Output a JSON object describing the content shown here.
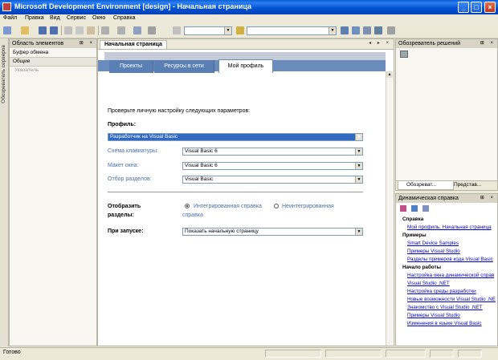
{
  "window": {
    "title": "Microsoft Development Environment [design] - Начальная страница"
  },
  "menu": [
    "Файл",
    "Правка",
    "Вид",
    "Сервис",
    "Окно",
    "Справка"
  ],
  "left_strip": {
    "label": "Обозреватель серверов"
  },
  "toolbox": {
    "title": "Область элементов",
    "sections": [
      "Буфер обмена",
      "Общие"
    ],
    "item": "Указатель"
  },
  "document": {
    "tab": "Начальная страница",
    "nav_tabs": [
      "Проекты",
      "Ресурсы в сети",
      "Мой профиль"
    ],
    "intro": "Проверьте личную настройку следующих параметров:",
    "profile_label": "Профиль:",
    "profile_value": "Разработчик на Visual Basic",
    "keyboard_label": "Схема клавиатуры:",
    "keyboard_value": "Visual Basic 6",
    "layout_label": "Макет окна:",
    "layout_value": "Visual Basic 6",
    "filter_label": "Отбор разделов:",
    "filter_value": "Visual Basic",
    "show_help_label_1": "Отобразить",
    "show_help_label_2": "разделы:",
    "help_integrated": "Интегрированная справка",
    "help_external_1": "Неинтегрированная",
    "help_external_2": "справка",
    "startup_label": "При запуске:",
    "startup_value": "Показать начальную страницу"
  },
  "solution": {
    "title": "Обозреватель решений",
    "tabs": [
      "Обозреват...",
      "Представ..."
    ]
  },
  "dynamic_help": {
    "title": "Динамическая справка",
    "groups": [
      {
        "name": "Справка",
        "links": [
          "Мой профиль, Начальная страница"
        ]
      },
      {
        "name": "Примеры",
        "links": [
          "Smart Device Samples",
          "Примеры Visual Studio",
          "Разделы примеров кода Visual Basic"
        ]
      },
      {
        "name": "Начало работы",
        "links": [
          "Настройка окна динамической справ",
          "Visual Studio .NET",
          "Настройка среды разработки",
          "Новые возможности Visual Studio .NE",
          "Знакомство с Visual Studio .NET",
          "Примеры Visual Studio",
          "Изменения в языке Visual Basic"
        ]
      }
    ]
  },
  "status": {
    "text": "Готово"
  },
  "colors": {
    "title_bar": "#0050d0",
    "nav_tab": "#5a7fb4",
    "link": "#0000cc",
    "selection": "#316ac5"
  }
}
